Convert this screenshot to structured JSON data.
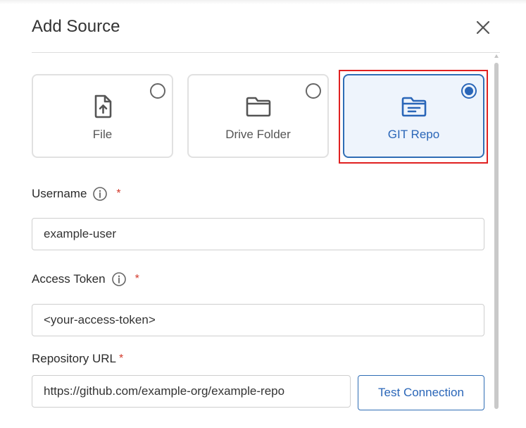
{
  "dialog": {
    "title": "Add Source"
  },
  "source_types": [
    {
      "label": "File",
      "icon": "file-upload-icon",
      "selected": false
    },
    {
      "label": "Drive Folder",
      "icon": "folder-icon",
      "selected": false
    },
    {
      "label": "GIT Repo",
      "icon": "repo-folder-icon",
      "selected": true
    }
  ],
  "form": {
    "username": {
      "label": "Username",
      "required_mark": "*",
      "value": "example-user"
    },
    "access_token": {
      "label": "Access Token",
      "required_mark": "*",
      "value": "<your-access-token>"
    },
    "repository_url": {
      "label": "Repository URL",
      "required_mark": "*",
      "value": "https://github.com/example-org/example-repo"
    },
    "test_connection_label": "Test Connection"
  },
  "colors": {
    "accent": "#2a66b8",
    "selected_bg": "#eef4fc",
    "required": "#d33a2c",
    "highlight": "#e02121"
  }
}
